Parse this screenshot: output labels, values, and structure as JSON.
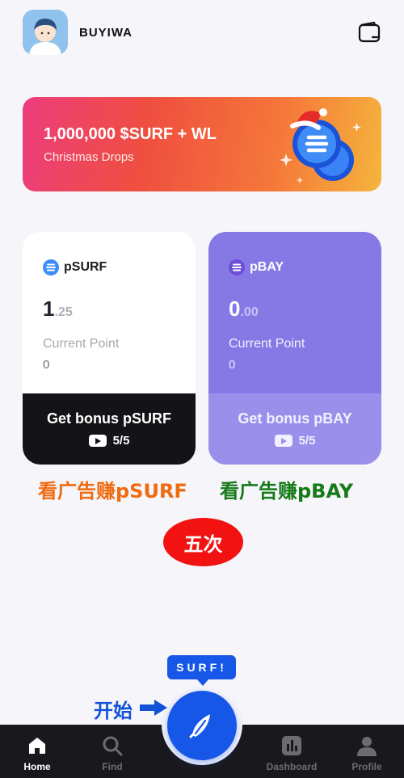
{
  "header": {
    "username": "BUYIWA",
    "avatar_icon": "avatar-icon",
    "wallet_icon": "wallet-icon"
  },
  "banner": {
    "title": "1,000,000 $SURF + WL",
    "subtitle": "Christmas Drops"
  },
  "cards": {
    "psurf": {
      "name": "pSURF",
      "amount_int": "1",
      "amount_dec": ".25",
      "point_label": "Current Point",
      "point_value": "0",
      "bonus_label": "Get bonus pSURF",
      "bonus_count": "5/5"
    },
    "pbay": {
      "name": "pBAY",
      "amount_int": "0",
      "amount_dec": ".00",
      "point_label": "Current Point",
      "point_value": "0",
      "bonus_label": "Get bonus pBAY",
      "bonus_count": "5/5"
    }
  },
  "annotations": {
    "psurf_note": "看广告赚pSURF",
    "pbay_note": "看广告赚pBAY",
    "times": "五次",
    "start": "开始"
  },
  "surf_tooltip": "SURF!",
  "nav": {
    "home": "Home",
    "find": "Find",
    "dashboard": "Dashboard",
    "profile": "Profile"
  },
  "colors": {
    "accent_blue": "#1757e8",
    "pbay_purple": "#8679e6",
    "annotation_orange": "#f06a10",
    "annotation_green": "#157a18",
    "annotation_red": "#f21212"
  }
}
